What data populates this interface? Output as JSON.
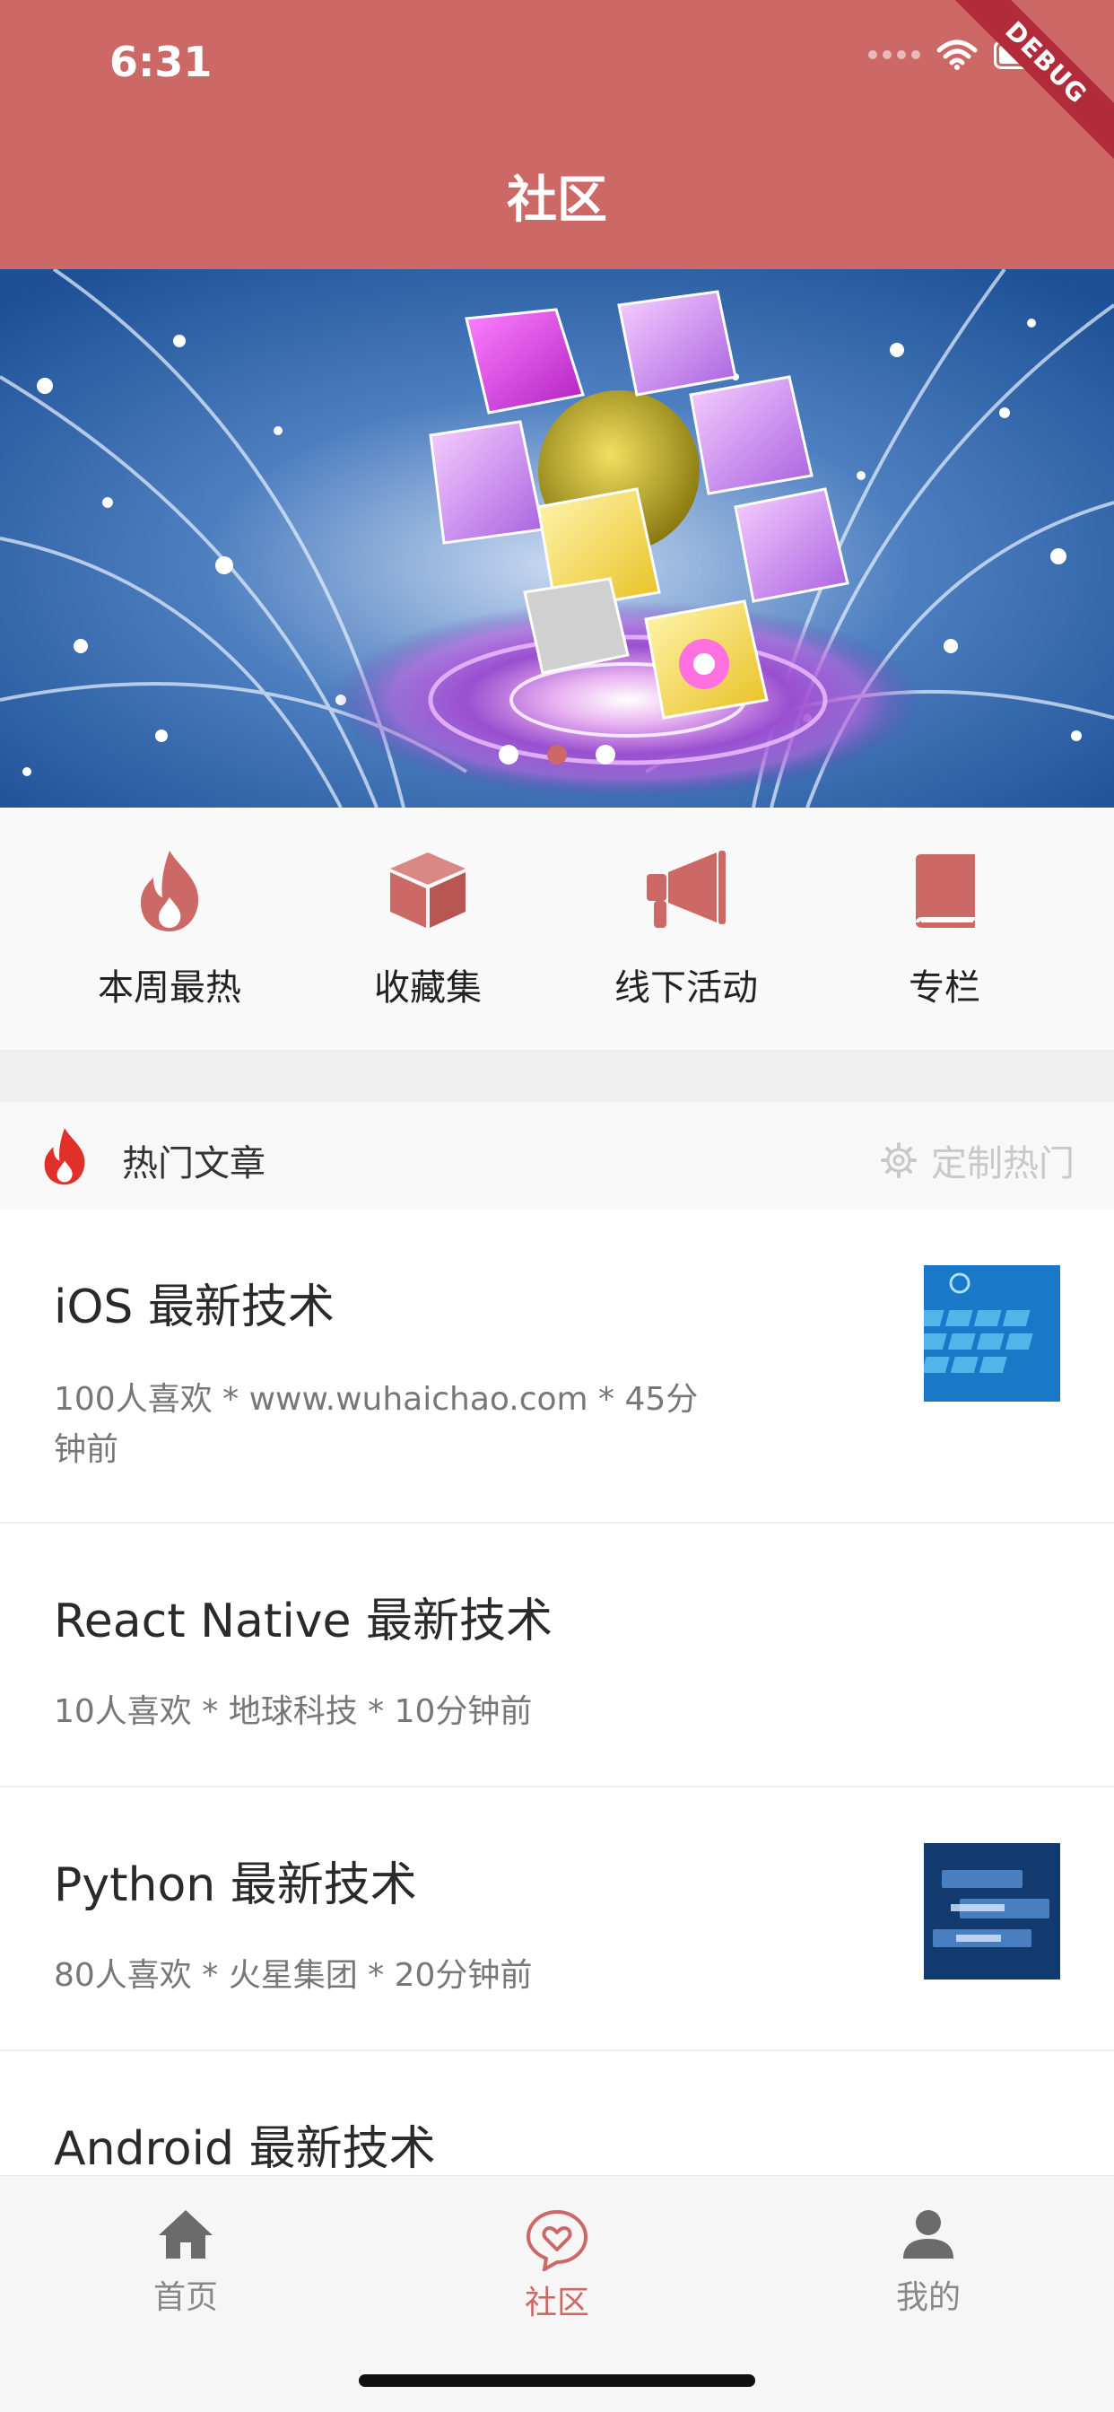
{
  "status_bar": {
    "time": "6:31",
    "debug_badge": "DEBUG"
  },
  "header": {
    "title": "社区",
    "background_color": "#cc6866"
  },
  "banner": {
    "page_count": 3,
    "active_index": 1,
    "image": "abstract-cubes-globe"
  },
  "quick_entries": [
    {
      "label": "本周最热",
      "icon": "flame-icon"
    },
    {
      "label": "收藏集",
      "icon": "cube-icon"
    },
    {
      "label": "线下活动",
      "icon": "megaphone-icon"
    },
    {
      "label": "专栏",
      "icon": "book-icon"
    }
  ],
  "section": {
    "title": "热门文章",
    "icon": "flame-icon",
    "action": "定制热门",
    "action_icon": "gear-icon"
  },
  "articles": [
    {
      "title": "iOS 最新技术",
      "meta": "100人喜欢 * www.wuhaichao.com * 45分钟前",
      "thumbnail": "blue-keyboard-image"
    },
    {
      "title": "React Native 最新技术",
      "meta": "10人喜欢 * 地球科技 * 10分钟前",
      "thumbnail": ""
    },
    {
      "title": "Python 最新技术",
      "meta": "80人喜欢 * 火星集团 * 20分钟前",
      "thumbnail": "blue-abstract-image"
    },
    {
      "title": "Android 最新技术",
      "meta": "",
      "thumbnail": ""
    }
  ],
  "tabs": [
    {
      "label": "首页",
      "icon": "home-icon",
      "active": false
    },
    {
      "label": "社区",
      "icon": "heart-bubble-icon",
      "active": true
    },
    {
      "label": "我的",
      "icon": "person-icon",
      "active": false
    }
  ],
  "colors": {
    "accent": "#cc6866",
    "flame_red": "#e0302a",
    "text_dark": "#2a2a2a",
    "text_meta": "#777777"
  }
}
